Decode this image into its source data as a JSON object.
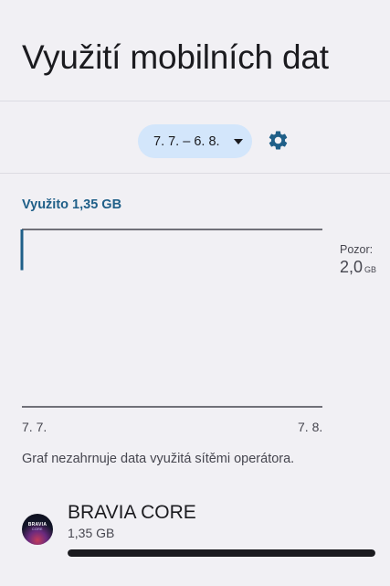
{
  "page": {
    "title": "Využití mobilních dat"
  },
  "cycle": {
    "label": "7. 7. – 6. 8."
  },
  "icons": {
    "settings": "gear-icon",
    "dropdown": "chevron-down-icon"
  },
  "colors": {
    "accent": "#1f5f88",
    "chip_bg": "#d3e6fb",
    "background": "#f1f0f4"
  },
  "usage": {
    "summary": "Využito 1,35 GB"
  },
  "chart_data": {
    "type": "line",
    "x_labels": [
      "7. 7.",
      "7. 8."
    ],
    "series": [
      {
        "x": [
          "7. 7.",
          "7. 7."
        ],
        "values": [
          0,
          1.35
        ]
      }
    ],
    "ylim": [
      0,
      2.0
    ],
    "y_unit": "GB",
    "warning": {
      "label": "Pozor:",
      "value": "2,0",
      "unit": "GB",
      "level": 2.0
    }
  },
  "note": "Graf nezahrnuje data využitá sítěmi operátora.",
  "apps": [
    {
      "name": "BRAVIA CORE",
      "usage": "1,35 GB",
      "fraction": 1.0,
      "icon_text_1": "BRAVIA",
      "icon_text_2": "CORE"
    }
  ]
}
